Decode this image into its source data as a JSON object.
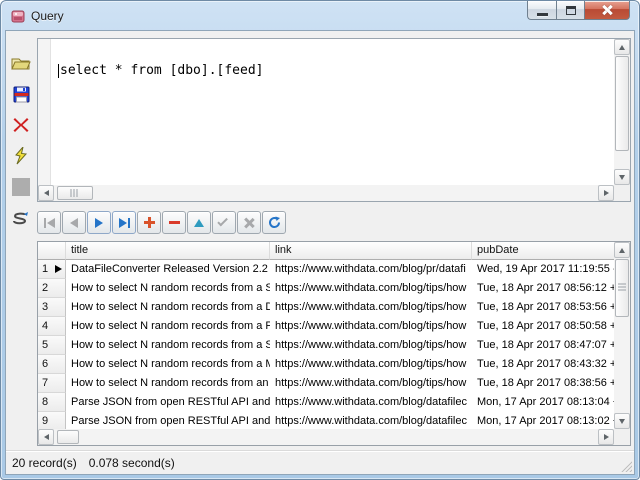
{
  "window": {
    "title": "Query",
    "control_icons": [
      "minimize-icon",
      "maximize-icon",
      "close-icon"
    ]
  },
  "toolbar": {
    "icons": [
      "open-file-icon",
      "save-icon",
      "clear-icon",
      "execute-lightning-icon",
      "stop-icon",
      "format-sql-icon"
    ]
  },
  "editor": {
    "sql": "select * from [dbo].[feed]"
  },
  "navigator": {
    "icons": [
      {
        "name": "first-record-icon",
        "enabled": false
      },
      {
        "name": "prior-record-icon",
        "enabled": false
      },
      {
        "name": "next-record-icon",
        "enabled": true
      },
      {
        "name": "last-record-icon",
        "enabled": true
      },
      {
        "name": "insert-record-icon",
        "enabled": true
      },
      {
        "name": "delete-record-icon",
        "enabled": true
      },
      {
        "name": "edit-record-icon",
        "enabled": true
      },
      {
        "name": "post-edit-icon",
        "enabled": false
      },
      {
        "name": "cancel-edit-icon",
        "enabled": false
      },
      {
        "name": "refresh-icon",
        "enabled": true
      }
    ]
  },
  "grid": {
    "columns": [
      "",
      "title",
      "link",
      "pubDate"
    ],
    "rows": [
      {
        "num": "1",
        "title": "DataFileConverter Released Version 2.2",
        "link": "https://www.withdata.com/blog/pr/datafi",
        "pubDate": "Wed, 19 Apr 2017 11:19:55 -"
      },
      {
        "num": "2",
        "title": "How to select N random records from a SQ",
        "link": "https://www.withdata.com/blog/tips/how",
        "pubDate": "Tue, 18 Apr 2017 08:56:12 +"
      },
      {
        "num": "3",
        "title": "How to select N random records from a DI",
        "link": "https://www.withdata.com/blog/tips/how",
        "pubDate": "Tue, 18 Apr 2017 08:53:56 +"
      },
      {
        "num": "4",
        "title": "How to select N random records from a Po",
        "link": "https://www.withdata.com/blog/tips/how",
        "pubDate": "Tue, 18 Apr 2017 08:50:58 +"
      },
      {
        "num": "5",
        "title": "How to select N random records from a SQ",
        "link": "https://www.withdata.com/blog/tips/how",
        "pubDate": "Tue, 18 Apr 2017 08:47:07 +"
      },
      {
        "num": "6",
        "title": "How to select N random records from a M",
        "link": "https://www.withdata.com/blog/tips/how",
        "pubDate": "Tue, 18 Apr 2017 08:43:32 +"
      },
      {
        "num": "7",
        "title": "How to select N random records from an O",
        "link": "https://www.withdata.com/blog/tips/how",
        "pubDate": "Tue, 18 Apr 2017 08:38:56 +"
      },
      {
        "num": "8",
        "title": "Parse JSON from open RESTful API and s",
        "link": "https://www.withdata.com/blog/datafilec",
        "pubDate": "Mon, 17 Apr 2017 08:13:04 +"
      },
      {
        "num": "9",
        "title": "Parse JSON from open RESTful API and s",
        "link": "https://www.withdata.com/blog/datafilec",
        "pubDate": "Mon, 17 Apr 2017 08:13:02 +"
      }
    ]
  },
  "status": {
    "records": "20 record(s)",
    "time": "0.078 second(s)"
  },
  "colors": {
    "titlebar_blue": "#b3d0ea",
    "close_red": "#c25a40",
    "accent_blue": "#2474c8",
    "nav_plus_red": "#d9532b",
    "nav_minus_red": "#d93b2b",
    "nav_teal": "#2e9bbf",
    "disabled_gray": "#a7a9ab",
    "client_gray": "#f0f0f0"
  }
}
